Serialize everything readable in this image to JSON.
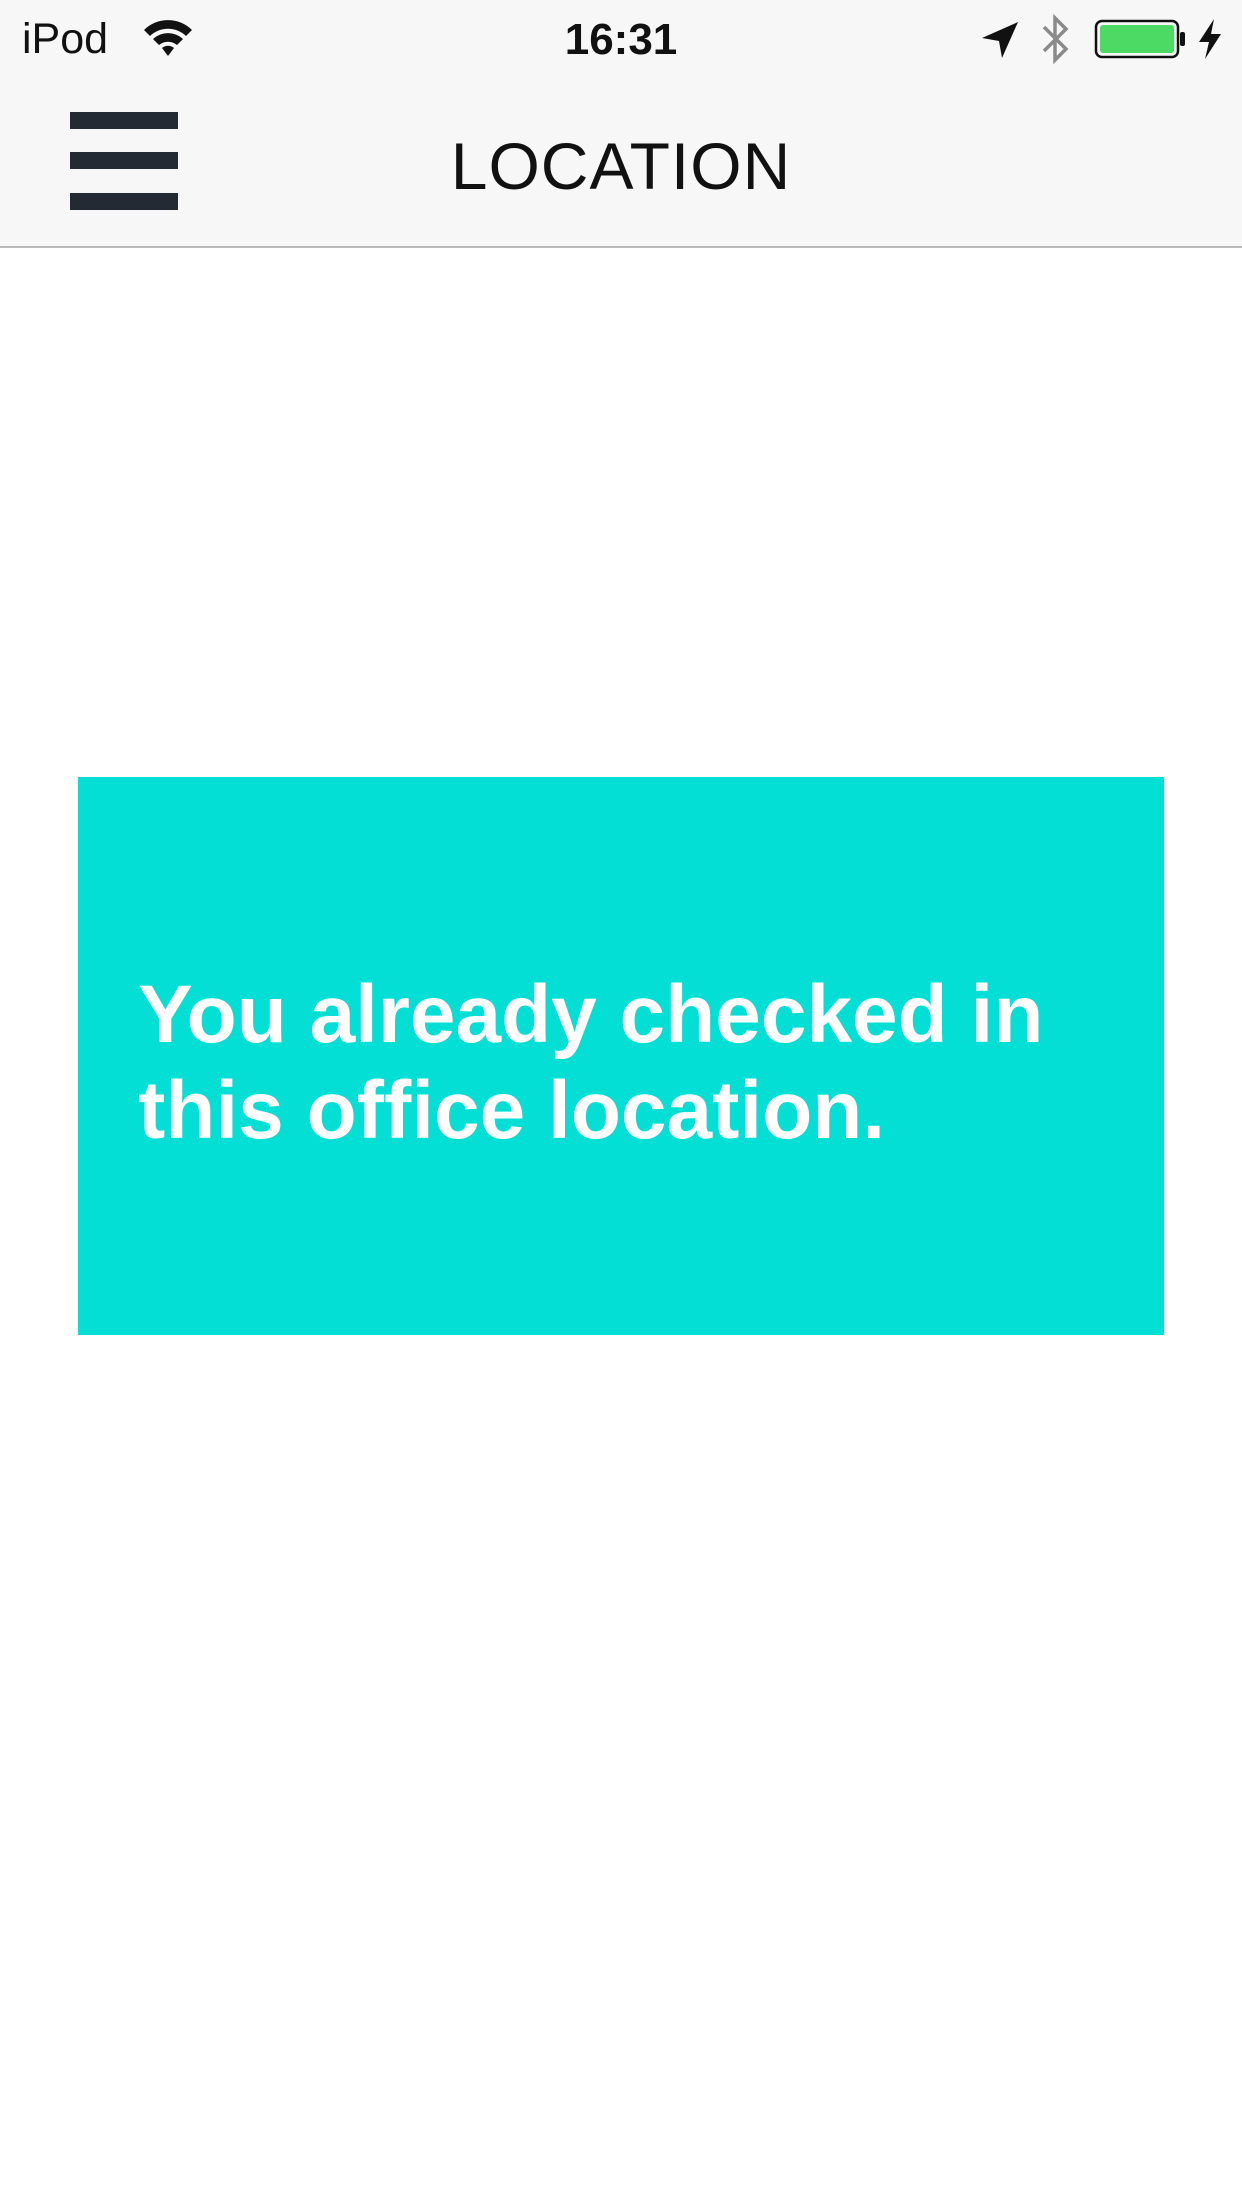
{
  "status_bar": {
    "carrier": "iPod",
    "time": "16:31",
    "icons": [
      "wifi-icon",
      "location-arrow-icon",
      "bluetooth-icon",
      "battery-icon",
      "charging-bolt-icon"
    ],
    "battery_color": "#4cd964"
  },
  "nav": {
    "title": "LOCATION",
    "menu_icon": "hamburger-menu-icon"
  },
  "message": {
    "text": "You already checked in this office location.",
    "background_color": "#04dfd6",
    "text_color": "#ffffff"
  }
}
